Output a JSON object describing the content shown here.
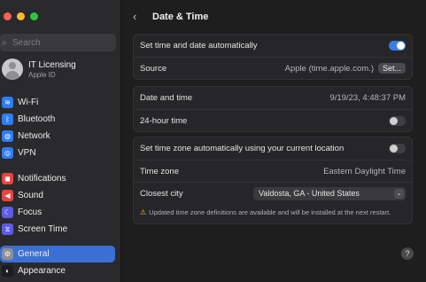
{
  "window": {
    "traffic_lights": {
      "close": "#ff5f57",
      "minimize": "#febc2e",
      "zoom": "#28c840"
    }
  },
  "sidebar": {
    "search_placeholder": "Search",
    "account": {
      "name": "IT Licensing",
      "subtitle": "Apple ID"
    },
    "items": [
      {
        "label": "Wi-Fi",
        "icon": "wifi-icon",
        "color": "#2f7cf6",
        "glyph": "≋"
      },
      {
        "label": "Bluetooth",
        "icon": "bluetooth-icon",
        "color": "#2f7cf6",
        "glyph": "ᛒ"
      },
      {
        "label": "Network",
        "icon": "network-icon",
        "color": "#2f7cf6",
        "glyph": "◍"
      },
      {
        "label": "VPN",
        "icon": "vpn-icon",
        "color": "#2f7cf6",
        "glyph": "◎"
      },
      {
        "label": "Notifications",
        "icon": "notifications-icon",
        "color": "#e8453c",
        "glyph": "◼"
      },
      {
        "label": "Sound",
        "icon": "sound-icon",
        "color": "#e8453c",
        "glyph": "◀"
      },
      {
        "label": "Focus",
        "icon": "focus-icon",
        "color": "#5e5ce6",
        "glyph": "☾"
      },
      {
        "label": "Screen Time",
        "icon": "screen-time-icon",
        "color": "#5e5ce6",
        "glyph": "⧖"
      },
      {
        "label": "General",
        "icon": "gear-icon",
        "color": "#8e8e93",
        "glyph": "⚙",
        "selected": true
      },
      {
        "label": "Appearance",
        "icon": "appearance-icon",
        "color": "#1c1c1e",
        "glyph": "◐"
      }
    ]
  },
  "header": {
    "title": "Date & Time",
    "back_icon": "chevron-left-icon"
  },
  "group1": {
    "auto_label": "Set time and date automatically",
    "auto_on": true,
    "source_label": "Source",
    "source_value": "Apple (time.apple.com.)",
    "source_button": "Set..."
  },
  "group2": {
    "datetime_label": "Date and time",
    "datetime_value": "9/19/23, 4:48:37 PM",
    "hour24_label": "24-hour time",
    "hour24_on": false
  },
  "group3": {
    "tz_auto_label": "Set time zone automatically using your current location",
    "tz_auto_on": false,
    "tz_label": "Time zone",
    "tz_value": "Eastern Daylight Time",
    "city_label": "Closest city",
    "city_value": "Valdosta, GA - United States",
    "notice": "Updated time zone definitions are available and will be installed at the next restart."
  },
  "help_label": "?"
}
